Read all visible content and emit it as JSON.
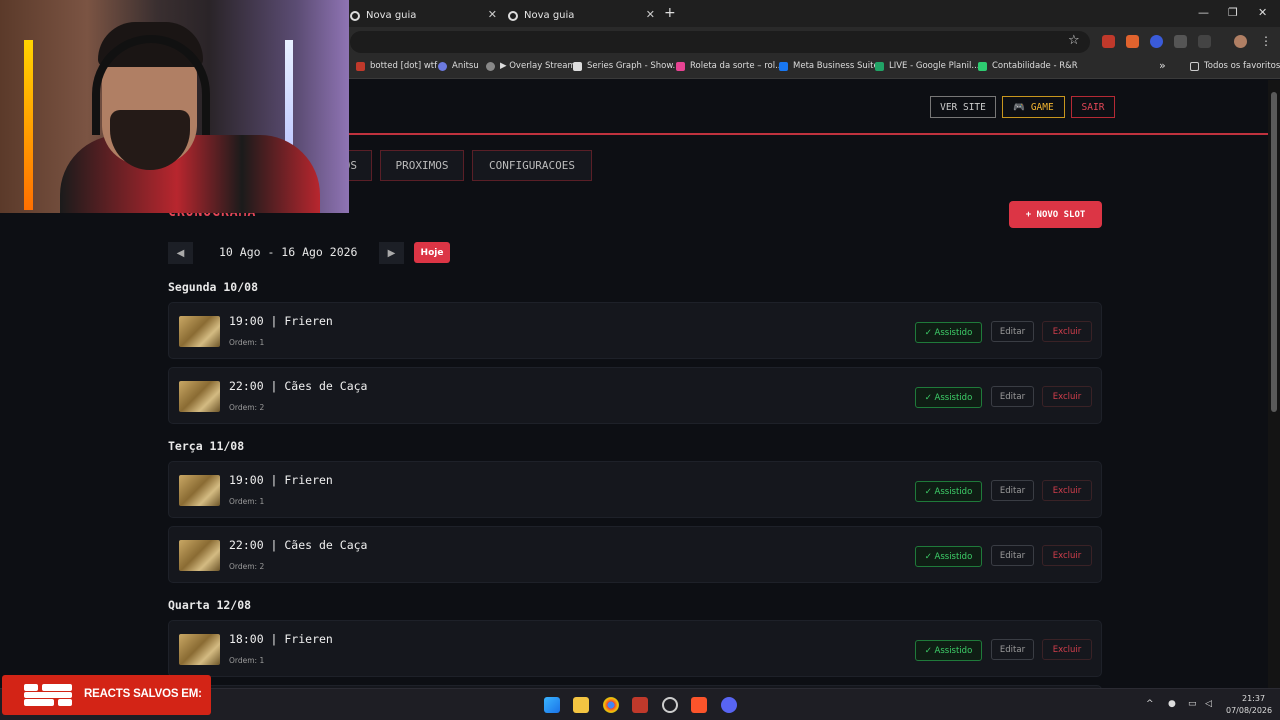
{
  "browser": {
    "tabs": [
      {
        "title": "Nova guia"
      },
      {
        "title": "Nova guia"
      }
    ],
    "new_tab_symbol": "+",
    "close_symbol": "✕",
    "window_controls": {
      "minimize": "—",
      "maximize": "❐",
      "close": "✕"
    },
    "bookmarks": [
      {
        "label": "botted [dot] wtf",
        "color": "#c0392b"
      },
      {
        "label": "Anitsu",
        "color": "#6c7ae0"
      },
      {
        "label": "▶ Overlay Stream",
        "color": "#888888"
      },
      {
        "label": "Series Graph - Show...",
        "color": "#dddddd"
      },
      {
        "label": "Roleta da sorte – rol...",
        "color": "#e84393"
      },
      {
        "label": "Meta Business Suite",
        "color": "#1877f2"
      },
      {
        "label": "LIVE - Google Planil...",
        "color": "#21a366"
      },
      {
        "label": "Contabilidade - R&R",
        "color": "#2ecc71"
      }
    ],
    "bookmarks_overflow": "»",
    "all_favorites": "Todos os favoritos",
    "star_symbol": "☆",
    "menu_symbol": "⋮"
  },
  "header": {
    "view_site": "VER SITE",
    "game": "🎮 GAME",
    "logout": "SAIR"
  },
  "nav": {
    "tabs": [
      {
        "label": "OS"
      },
      {
        "label": "PROXIMOS"
      },
      {
        "label": "CONFIGURACOES"
      }
    ]
  },
  "schedule": {
    "title": "CRONOGRAMA",
    "new_slot": "+ NOVO SLOT",
    "prev_symbol": "◀",
    "next_symbol": "▶",
    "week_range": "10 Ago - 16 Ago 2026",
    "today": "Hoje",
    "watched_label": "✓ Assistido",
    "edit_label": "Editar",
    "delete_label": "Excluir",
    "days": [
      {
        "heading": "Segunda 10/08",
        "slots": [
          {
            "title": "19:00 | Frieren",
            "order": "Ordem: 1"
          },
          {
            "title": "22:00 | Cães de Caça",
            "order": "Ordem: 2"
          }
        ]
      },
      {
        "heading": "Terça 11/08",
        "slots": [
          {
            "title": "19:00 | Frieren",
            "order": "Ordem: 1"
          },
          {
            "title": "22:00 | Cães de Caça",
            "order": "Ordem: 2"
          }
        ]
      },
      {
        "heading": "Quarta 12/08",
        "slots": [
          {
            "title": "18:00 | Frieren",
            "order": "Ordem: 1"
          }
        ]
      }
    ]
  },
  "overlay": {
    "reacts_text": "REACTS SALVOS EM:"
  },
  "taskbar": {
    "time": "21:37",
    "date": "07/08/2026"
  },
  "colors": {
    "accent_red": "#dc3545",
    "watched_green": "#3ecf69",
    "game_gold": "#f1b431",
    "background": "#0d0f14"
  }
}
